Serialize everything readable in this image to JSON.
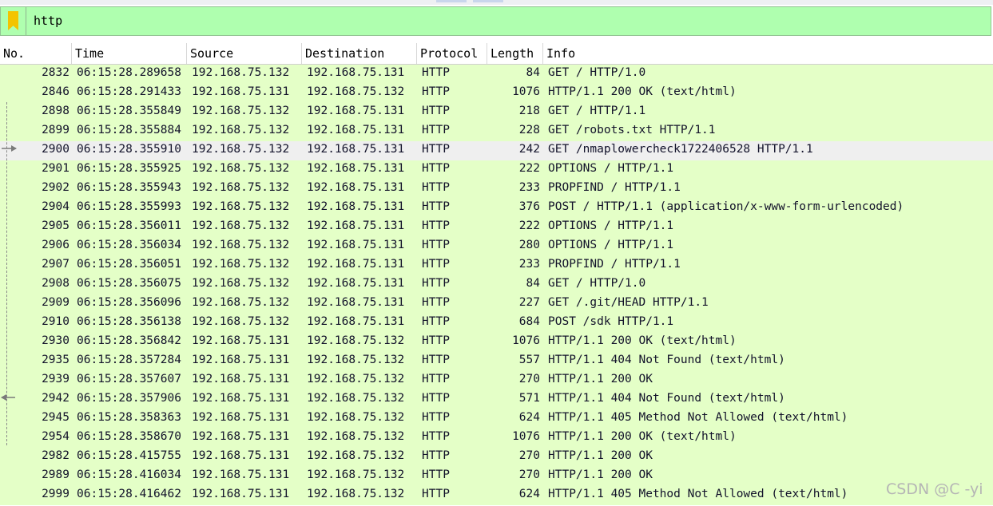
{
  "filter": {
    "value": "http",
    "icon": "bookmark-icon"
  },
  "columns": {
    "no": "No.",
    "time": "Time",
    "source": "Source",
    "destination": "Destination",
    "protocol": "Protocol",
    "length": "Length",
    "info": "Info"
  },
  "colors": {
    "row_bg": "#e4ffc7",
    "selected_bg": "#efefef",
    "filter_bg": "#afffaf"
  },
  "packets": [
    {
      "no": "2832",
      "time": "06:15:28.289658",
      "src": "192.168.75.132",
      "dst": "192.168.75.131",
      "proto": "HTTP",
      "len": "84",
      "info": "GET / HTTP/1.0"
    },
    {
      "no": "2846",
      "time": "06:15:28.291433",
      "src": "192.168.75.131",
      "dst": "192.168.75.132",
      "proto": "HTTP",
      "len": "1076",
      "info": "HTTP/1.1 200 OK  (text/html)"
    },
    {
      "no": "2898",
      "time": "06:15:28.355849",
      "src": "192.168.75.132",
      "dst": "192.168.75.131",
      "proto": "HTTP",
      "len": "218",
      "info": "GET / HTTP/1.1"
    },
    {
      "no": "2899",
      "time": "06:15:28.355884",
      "src": "192.168.75.132",
      "dst": "192.168.75.131",
      "proto": "HTTP",
      "len": "228",
      "info": "GET /robots.txt HTTP/1.1"
    },
    {
      "no": "2900",
      "time": "06:15:28.355910",
      "src": "192.168.75.132",
      "dst": "192.168.75.131",
      "proto": "HTTP",
      "len": "242",
      "info": "GET /nmaplowercheck1722406528 HTTP/1.1",
      "selected": true
    },
    {
      "no": "2901",
      "time": "06:15:28.355925",
      "src": "192.168.75.132",
      "dst": "192.168.75.131",
      "proto": "HTTP",
      "len": "222",
      "info": "OPTIONS / HTTP/1.1"
    },
    {
      "no": "2902",
      "time": "06:15:28.355943",
      "src": "192.168.75.132",
      "dst": "192.168.75.131",
      "proto": "HTTP",
      "len": "233",
      "info": "PROPFIND / HTTP/1.1"
    },
    {
      "no": "2904",
      "time": "06:15:28.355993",
      "src": "192.168.75.132",
      "dst": "192.168.75.131",
      "proto": "HTTP",
      "len": "376",
      "info": "POST / HTTP/1.1  (application/x-www-form-urlencoded)"
    },
    {
      "no": "2905",
      "time": "06:15:28.356011",
      "src": "192.168.75.132",
      "dst": "192.168.75.131",
      "proto": "HTTP",
      "len": "222",
      "info": "OPTIONS / HTTP/1.1"
    },
    {
      "no": "2906",
      "time": "06:15:28.356034",
      "src": "192.168.75.132",
      "dst": "192.168.75.131",
      "proto": "HTTP",
      "len": "280",
      "info": "OPTIONS / HTTP/1.1"
    },
    {
      "no": "2907",
      "time": "06:15:28.356051",
      "src": "192.168.75.132",
      "dst": "192.168.75.131",
      "proto": "HTTP",
      "len": "233",
      "info": "PROPFIND / HTTP/1.1"
    },
    {
      "no": "2908",
      "time": "06:15:28.356075",
      "src": "192.168.75.132",
      "dst": "192.168.75.131",
      "proto": "HTTP",
      "len": "84",
      "info": "GET / HTTP/1.0"
    },
    {
      "no": "2909",
      "time": "06:15:28.356096",
      "src": "192.168.75.132",
      "dst": "192.168.75.131",
      "proto": "HTTP",
      "len": "227",
      "info": "GET /.git/HEAD HTTP/1.1"
    },
    {
      "no": "2910",
      "time": "06:15:28.356138",
      "src": "192.168.75.132",
      "dst": "192.168.75.131",
      "proto": "HTTP",
      "len": "684",
      "info": "POST /sdk HTTP/1.1"
    },
    {
      "no": "2930",
      "time": "06:15:28.356842",
      "src": "192.168.75.131",
      "dst": "192.168.75.132",
      "proto": "HTTP",
      "len": "1076",
      "info": "HTTP/1.1 200 OK  (text/html)"
    },
    {
      "no": "2935",
      "time": "06:15:28.357284",
      "src": "192.168.75.131",
      "dst": "192.168.75.132",
      "proto": "HTTP",
      "len": "557",
      "info": "HTTP/1.1 404 Not Found  (text/html)"
    },
    {
      "no": "2939",
      "time": "06:15:28.357607",
      "src": "192.168.75.131",
      "dst": "192.168.75.132",
      "proto": "HTTP",
      "len": "270",
      "info": "HTTP/1.1 200 OK"
    },
    {
      "no": "2942",
      "time": "06:15:28.357906",
      "src": "192.168.75.131",
      "dst": "192.168.75.132",
      "proto": "HTTP",
      "len": "571",
      "info": "HTTP/1.1 404 Not Found  (text/html)"
    },
    {
      "no": "2945",
      "time": "06:15:28.358363",
      "src": "192.168.75.131",
      "dst": "192.168.75.132",
      "proto": "HTTP",
      "len": "624",
      "info": "HTTP/1.1 405 Method Not Allowed  (text/html)"
    },
    {
      "no": "2954",
      "time": "06:15:28.358670",
      "src": "192.168.75.131",
      "dst": "192.168.75.132",
      "proto": "HTTP",
      "len": "1076",
      "info": "HTTP/1.1 200 OK  (text/html)"
    },
    {
      "no": "2982",
      "time": "06:15:28.415755",
      "src": "192.168.75.131",
      "dst": "192.168.75.132",
      "proto": "HTTP",
      "len": "270",
      "info": "HTTP/1.1 200 OK"
    },
    {
      "no": "2989",
      "time": "06:15:28.416034",
      "src": "192.168.75.131",
      "dst": "192.168.75.132",
      "proto": "HTTP",
      "len": "270",
      "info": "HTTP/1.1 200 OK"
    },
    {
      "no": "2999",
      "time": "06:15:28.416462",
      "src": "192.168.75.131",
      "dst": "192.168.75.132",
      "proto": "HTTP",
      "len": "624",
      "info": "HTTP/1.1 405 Method Not Allowed  (text/html)"
    }
  ],
  "watermark": "CSDN @C -yi"
}
